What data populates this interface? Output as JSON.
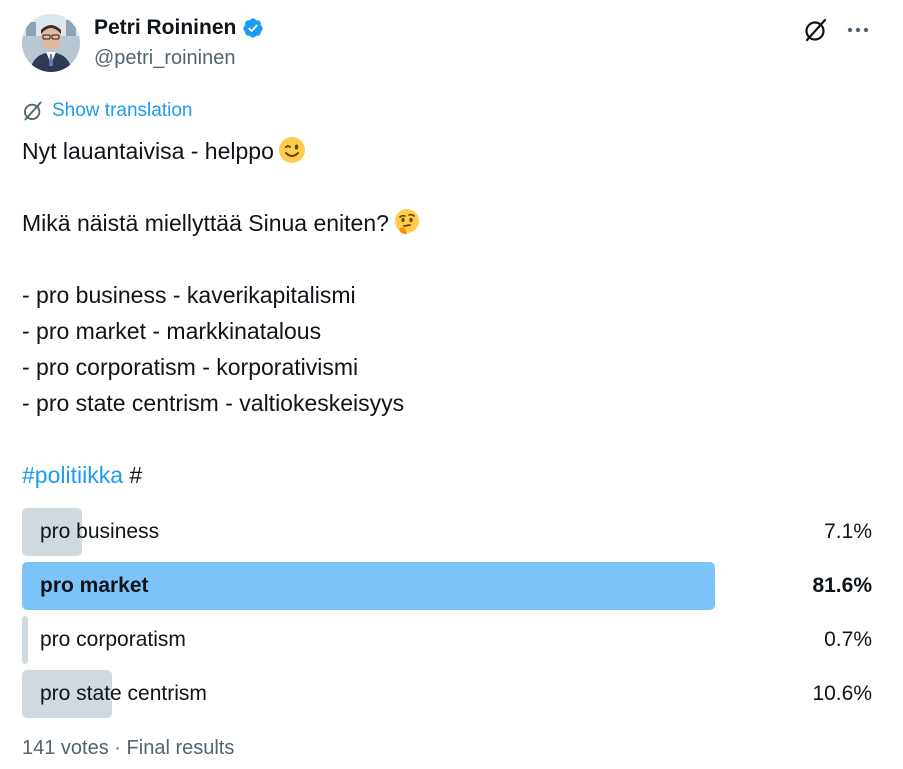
{
  "author": {
    "display_name": "Petri Roininen",
    "handle": "@petri_roininen",
    "verified": true
  },
  "icons": {
    "verified": "verified-badge-icon",
    "grok": "grok-icon",
    "more": "more-options-icon",
    "translate": "translate-icon"
  },
  "translation": {
    "label": "Show translation"
  },
  "tweet": {
    "line1": "Nyt lauantaivisa - helppo",
    "line1_emoji": "winking-face",
    "line2": "Mikä näistä miellyttää Sinua eniten?",
    "line2_emoji": "thinking-face",
    "options_text": [
      "- pro business - kaverikapitalismi",
      "- pro market - markkinatalous",
      "- pro corporatism - korporativismi",
      "- pro state centrism - valtiokeskeisyys"
    ],
    "hashtag": "#politiikka",
    "trailing_hash": "#"
  },
  "poll": {
    "options": [
      {
        "label": "pro business",
        "percent_label": "7.1%",
        "share": 0.071,
        "winner": false
      },
      {
        "label": "pro market",
        "percent_label": "81.6%",
        "share": 0.816,
        "winner": true
      },
      {
        "label": "pro corporatism",
        "percent_label": "0.7%",
        "share": 0.007,
        "winner": false
      },
      {
        "label": "pro state centrism",
        "percent_label": "10.6%",
        "share": 0.106,
        "winner": false
      }
    ],
    "votes_label": "141 votes",
    "separator": "·",
    "status_label": "Final results"
  },
  "colors": {
    "accent": "#1d9bf0",
    "winner_bar": "#7cc4f8",
    "bar": "#cfd9de",
    "secondary_text": "#536471",
    "verified": "#1d9bf0"
  }
}
